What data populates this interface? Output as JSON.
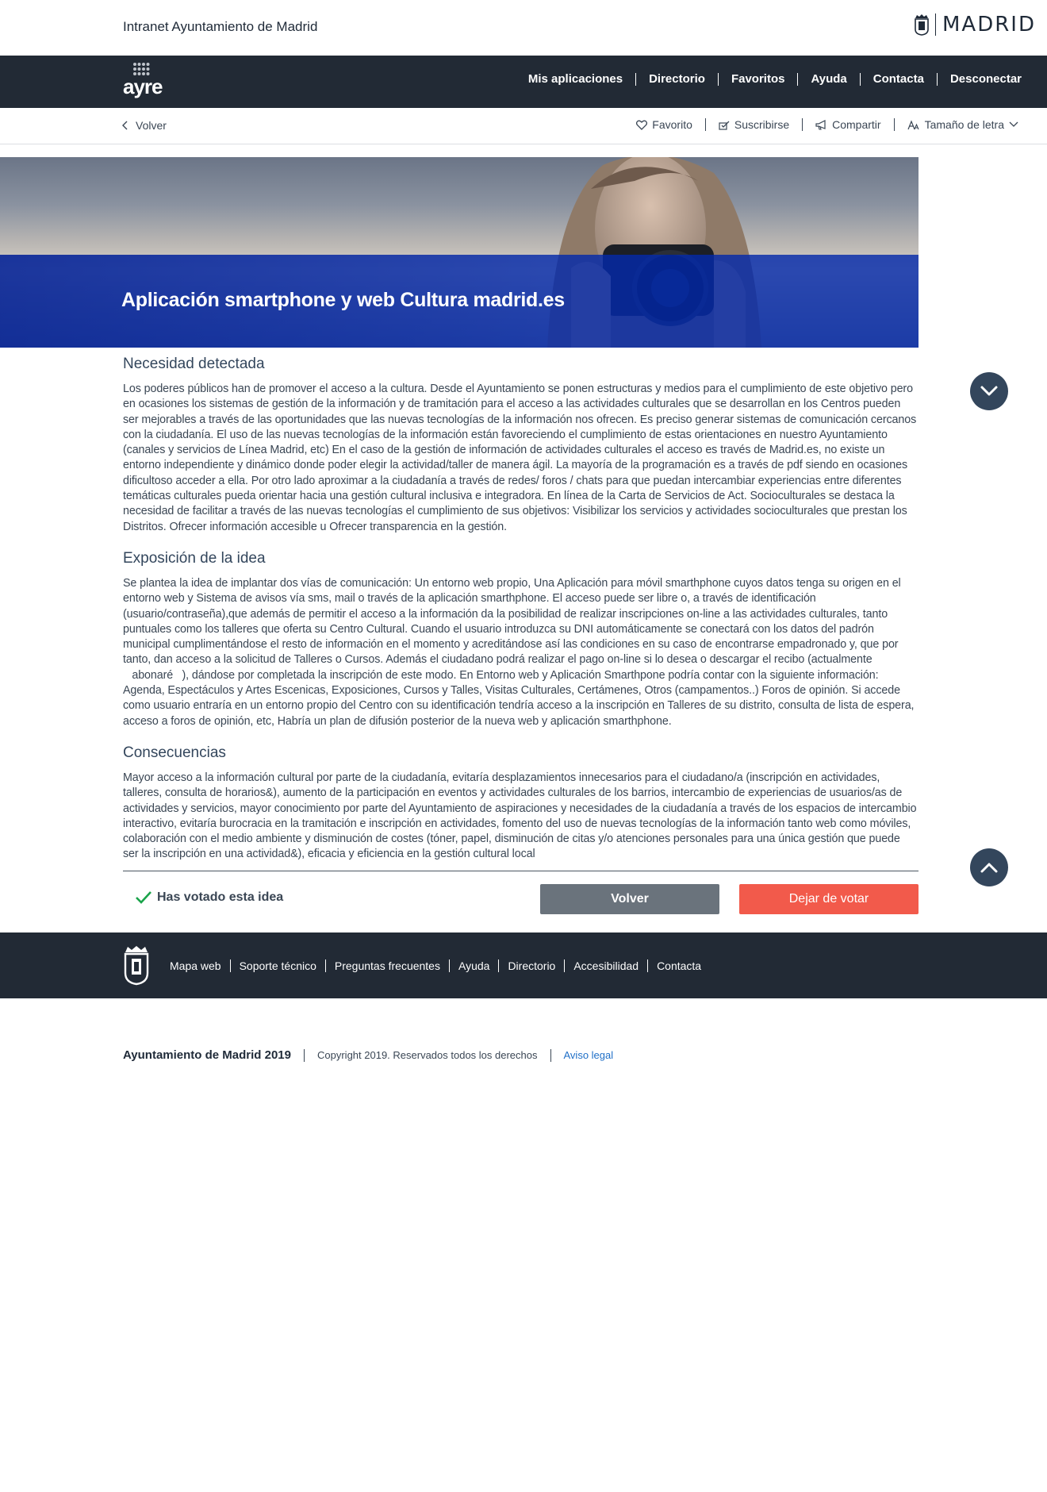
{
  "header": {
    "site_title": "Intranet Ayuntamiento de Madrid",
    "brand_word": "MADRID"
  },
  "nav": {
    "logo_text": "ayre",
    "items": [
      "Mis aplicaciones",
      "Directorio",
      "Favoritos",
      "Ayuda",
      "Contacta",
      "Desconectar"
    ]
  },
  "utility": {
    "back_label": "Volver",
    "favorite_label": "Favorito",
    "subscribe_label": "Suscribirse",
    "share_label": "Compartir",
    "font_size_label": "Tamaño de letra"
  },
  "hero": {
    "title": "Aplicación smartphone y web Cultura madrid.es"
  },
  "sections": [
    {
      "title": "Necesidad detectada",
      "text": "Los poderes públicos han de promover el acceso a la cultura. Desde el Ayuntamiento se ponen estructuras y medios para el cumplimiento de este objetivo pero en ocasiones los sistemas de gestión de la información y de tramitación para el acceso a las actividades culturales que se desarrollan en los Centros pueden ser mejorables a través de las oportunidades que las nuevas tecnologías de la información nos ofrecen. Es preciso generar sistemas de comunicación cercanos con la ciudadanía. El uso de las nuevas tecnologías de la información están favoreciendo el cumplimiento de estas orientaciones en nuestro Ayuntamiento (canales y servicios de Línea Madrid, etc) En el caso de la gestión de información de actividades culturales el acceso es través de Madrid.es, no existe un entorno independiente y dinámico donde poder elegir la actividad/taller de manera ágil. La mayoría de la programación es a través de pdf siendo en ocasiones dificultoso acceder a ella. Por otro lado aproximar a la ciudadanía a través de redes/ foros / chats para que puedan intercambiar experiencias entre diferentes temáticas culturales pueda orientar hacia una gestión cultural inclusiva e integradora. En línea de la Carta de Servicios de Act. Socioculturales se destaca la necesidad de facilitar a través de las nuevas tecnologías el cumplimiento de sus objetivos: Visibilizar los servicios y actividades socioculturales que prestan los Distritos. Ofrecer información accesible u Ofrecer transparencia en la gestión."
    },
    {
      "title": "Exposición de la idea",
      "text": "Se plantea la idea de implantar dos vías de comunicación: Un entorno web propio, Una Aplicación para móvil smarthphone cuyos datos tenga su origen en el entorno web y Sistema de avisos vía sms, mail o través de la aplicación smarthphone. El acceso puede ser libre o, a través de identificación (usuario/contraseña),que además de permitir el acceso a la información da la posibilidad de realizar inscripciones on-line a las actividades culturales, tanto puntuales como los talleres que oferta su Centro Cultural. Cuando el usuario introduzca su DNI automáticamente se conectará con los datos del padrón municipal cumplimentándose el resto de información en el momento y acreditándose así las condiciones en su caso de encontrarse empadronado y, que por tanto, dan acceso a la solicitud de Talleres o Cursos. Además el ciudadano podrá realizar el pago on-line si lo desea o descargar el recibo (actualmente abonaré), dándose por completada la inscripción de este modo. En Entorno web y Aplicación Smarthpone podría contar con la siguiente información: Agenda, Espectáculos y Artes Escenicas, Exposiciones, Cursos y Talles, Visitas Culturales, Certámenes, Otros (campamentos..) Foros de opinión. Si accede como usuario entraría en un entorno propio del Centro con su identificación tendría acceso a la inscripción en Talleres de su distrito, consulta de lista de espera, acceso a foros de opinión, etc, Habría un plan de difusión posterior de la nueva web y aplicación smarthphone."
    },
    {
      "title": "Consecuencias",
      "text": "Mayor acceso a la información cultural por parte de la ciudadanía, evitaría desplazamientos innecesarios para el ciudadano/a (inscripción en actividades, talleres, consulta de horarios&), aumento de la participación en eventos y actividades culturales de los barrios, intercambio de experiencias de usuarios/as de actividades y servicios, mayor conocimiento por parte del Ayuntamiento de aspiraciones y necesidades de la ciudadanía a través de los espacios de intercambio interactivo, evitaría burocracia en la tramitación e inscripción en actividades, fomento del uso de nuevas tecnologías de la información tanto web como móviles, colaboración con el medio ambiente y disminución de costes (tóner, papel, disminución de citas y/o atenciones personales para una única gestión que puede ser la inscripción en una actividad&), eficacia y eficiencia en la gestión cultural local"
    }
  ],
  "vote": {
    "status": "Has votado esta idea",
    "back_label": "Volver",
    "unvote_label": "Dejar de votar"
  },
  "footer": {
    "links": [
      "Mapa web",
      "Soporte técnico",
      "Preguntas frecuentes",
      "Ayuda",
      "Directorio",
      "Accesibilidad",
      "Contacta"
    ]
  },
  "legal": {
    "org": "Ayuntamiento de Madrid 2019",
    "copyright": "Copyright 2019. Reservados todos los derechos",
    "aviso": "Aviso legal"
  },
  "colors": {
    "nav_bg": "#222a35",
    "hero_band": "#042aaa",
    "accent_red": "#f25a4b",
    "button_gray": "#6a737c",
    "float_button": "#33465c",
    "check_green": "#1aa34a",
    "link_blue": "#1f6fc7"
  },
  "icons": [
    "madrid-crest-icon",
    "ayre-dots-icon",
    "chevron-left-icon",
    "heart-icon",
    "subscribe-icon",
    "megaphone-icon",
    "font-size-icon",
    "chevron-down-icon",
    "chevron-up-icon",
    "checkmark-icon"
  ]
}
